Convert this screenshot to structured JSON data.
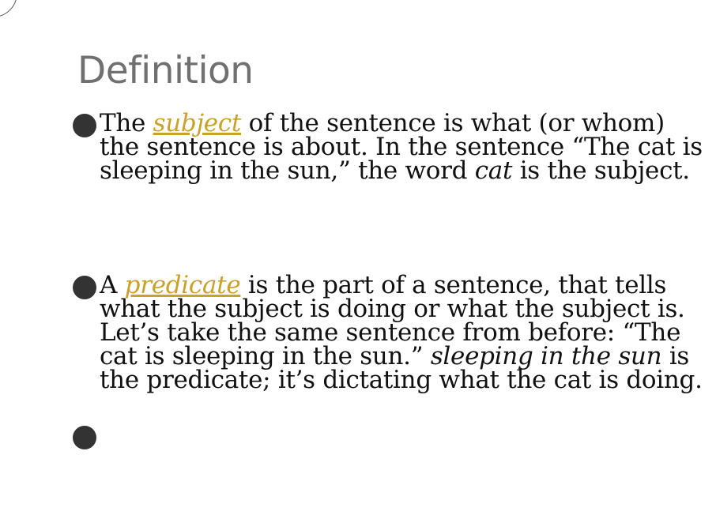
{
  "slide": {
    "title": "Definition",
    "bullets": [
      {
        "prefix": "The ",
        "term": "subject",
        "text_a": " of the sentence is what (or whom) the sentence is about. In the sentence “The cat is sleeping in the sun,” the word ",
        "italic": "cat",
        "text_b": " is the subject."
      },
      {
        "prefix": "A ",
        "term": "predicate",
        "text_a": " is the part of a sentence, that tells what the subject is doing or what the subject is. Let’s take the same sentence from before: “The cat is sleeping in the sun.” ",
        "italic": "sleeping in the sun",
        "text_b": " is the predicate; it’s dictating what the cat is doing."
      },
      {
        "text": ""
      }
    ]
  }
}
